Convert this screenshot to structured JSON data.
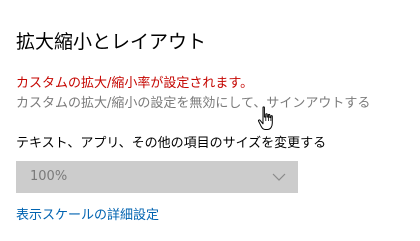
{
  "page": {
    "title": "拡大縮小とレイアウト"
  },
  "scaling": {
    "warning_text": "カスタムの拡大/縮小率が設定されます。",
    "signout_link": "カスタムの拡大/縮小の設定を無効にして、サインアウトする"
  },
  "text_size": {
    "label": "テキスト、アプリ、その他の項目のサイズを変更する",
    "selected_value": "100%",
    "disabled": true
  },
  "advanced": {
    "link_text": "表示スケールの詳細設定"
  },
  "pointer": {
    "icon": "hand-pointer-icon"
  },
  "colors": {
    "warning": "#c50500",
    "link": "#0063b1",
    "disabled_text": "#7a7a7a",
    "dropdown_bg": "#cccccc"
  }
}
